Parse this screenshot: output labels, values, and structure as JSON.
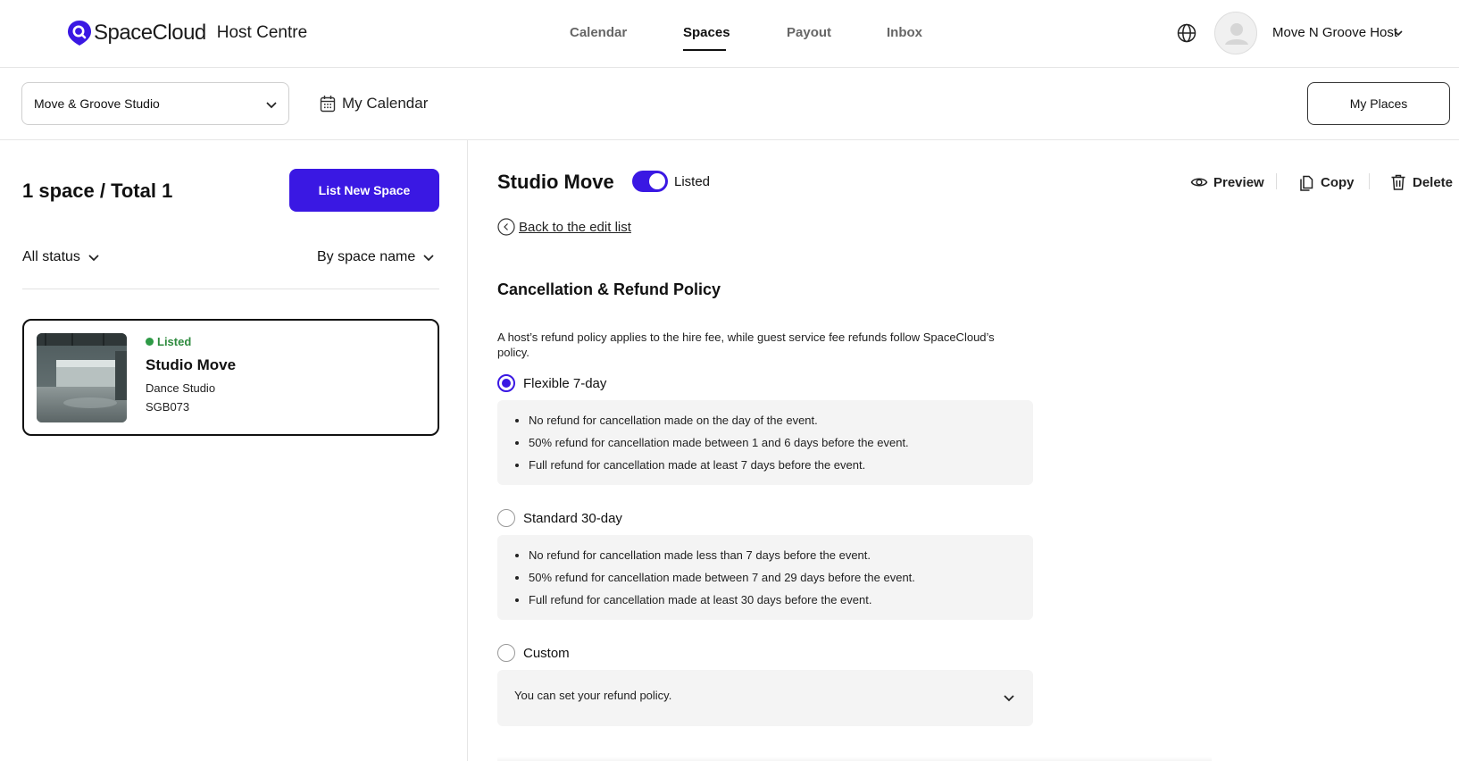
{
  "header": {
    "brand": "SpaceCloud",
    "brand_sub": "Host Centre",
    "nav": [
      "Calendar",
      "Spaces",
      "Payout",
      "Inbox"
    ],
    "active_nav": "Spaces",
    "host_name": "Move N Groove Host"
  },
  "subbar": {
    "place_selected": "Move & Groove Studio",
    "my_calendar": "My Calendar",
    "my_places": "My Places"
  },
  "left": {
    "count": "1 space / Total 1",
    "list_new": "List New Space",
    "status_filter": "All status",
    "sort_filter": "By space name",
    "card": {
      "status": "Listed",
      "title": "Studio Move",
      "type": "Dance Studio",
      "code": "SGB073"
    }
  },
  "right": {
    "space_title": "Studio Move",
    "toggle_label": "Listed",
    "actions": {
      "preview": "Preview",
      "copy": "Copy",
      "delete": "Delete"
    },
    "back": "Back to the edit list",
    "section_title": "Cancellation & Refund Policy",
    "section_desc": "A host’s refund policy applies to the hire fee, while guest service fee refunds follow SpaceCloud’s policy.",
    "options": [
      {
        "label": "Flexible 7-day",
        "selected": true,
        "items": [
          "No refund for cancellation made on the day of the event.",
          "50% refund for cancellation made between 1 and 6 days before the event.",
          "Full refund for cancellation made at least 7 days before the event."
        ]
      },
      {
        "label": "Standard 30-day",
        "selected": false,
        "items": [
          "No refund for cancellation made less than 7 days before the event.",
          "50% refund for cancellation made between 7 and 29 days before the event.",
          "Full refund for cancellation made at least 30 days before the event."
        ]
      },
      {
        "label": "Custom",
        "selected": false,
        "note": "You can set your refund policy."
      }
    ]
  },
  "colors": {
    "accent": "#3a18e3",
    "listed_green": "#2e8b3e"
  }
}
